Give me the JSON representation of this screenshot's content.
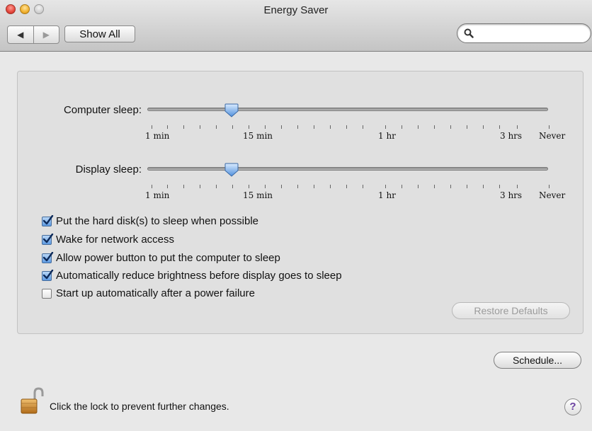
{
  "window": {
    "title": "Energy Saver"
  },
  "toolbar": {
    "back_glyph": "◀",
    "forward_glyph": "▶",
    "show_all_label": "Show All",
    "search_value": "",
    "search_placeholder": ""
  },
  "sliders": [
    {
      "label": "Computer sleep:",
      "value_label": "15 min",
      "position": 0.21,
      "ticks": [
        "1 min",
        "15 min",
        "1 hr",
        "3 hrs",
        "Never"
      ]
    },
    {
      "label": "Display sleep:",
      "value_label": "15 min",
      "position": 0.21,
      "ticks": [
        "1 min",
        "15 min",
        "1 hr",
        "3 hrs",
        "Never"
      ]
    }
  ],
  "options": [
    {
      "label": "Put the hard disk(s) to sleep when possible",
      "checked": true
    },
    {
      "label": "Wake for network access",
      "checked": true
    },
    {
      "label": "Allow power button to put the computer to sleep",
      "checked": true
    },
    {
      "label": "Automatically reduce brightness before display goes to sleep",
      "checked": true
    },
    {
      "label": "Start up automatically after a power failure",
      "checked": false
    }
  ],
  "buttons": {
    "restore_defaults": "Restore Defaults",
    "schedule": "Schedule..."
  },
  "footer": {
    "lock_text": "Click the lock to prevent further changes.",
    "help_glyph": "?"
  },
  "colors": {
    "accent": "#5d9ae2",
    "lock_gold": "#c98a2a",
    "help_purple": "#6a3fa0"
  }
}
